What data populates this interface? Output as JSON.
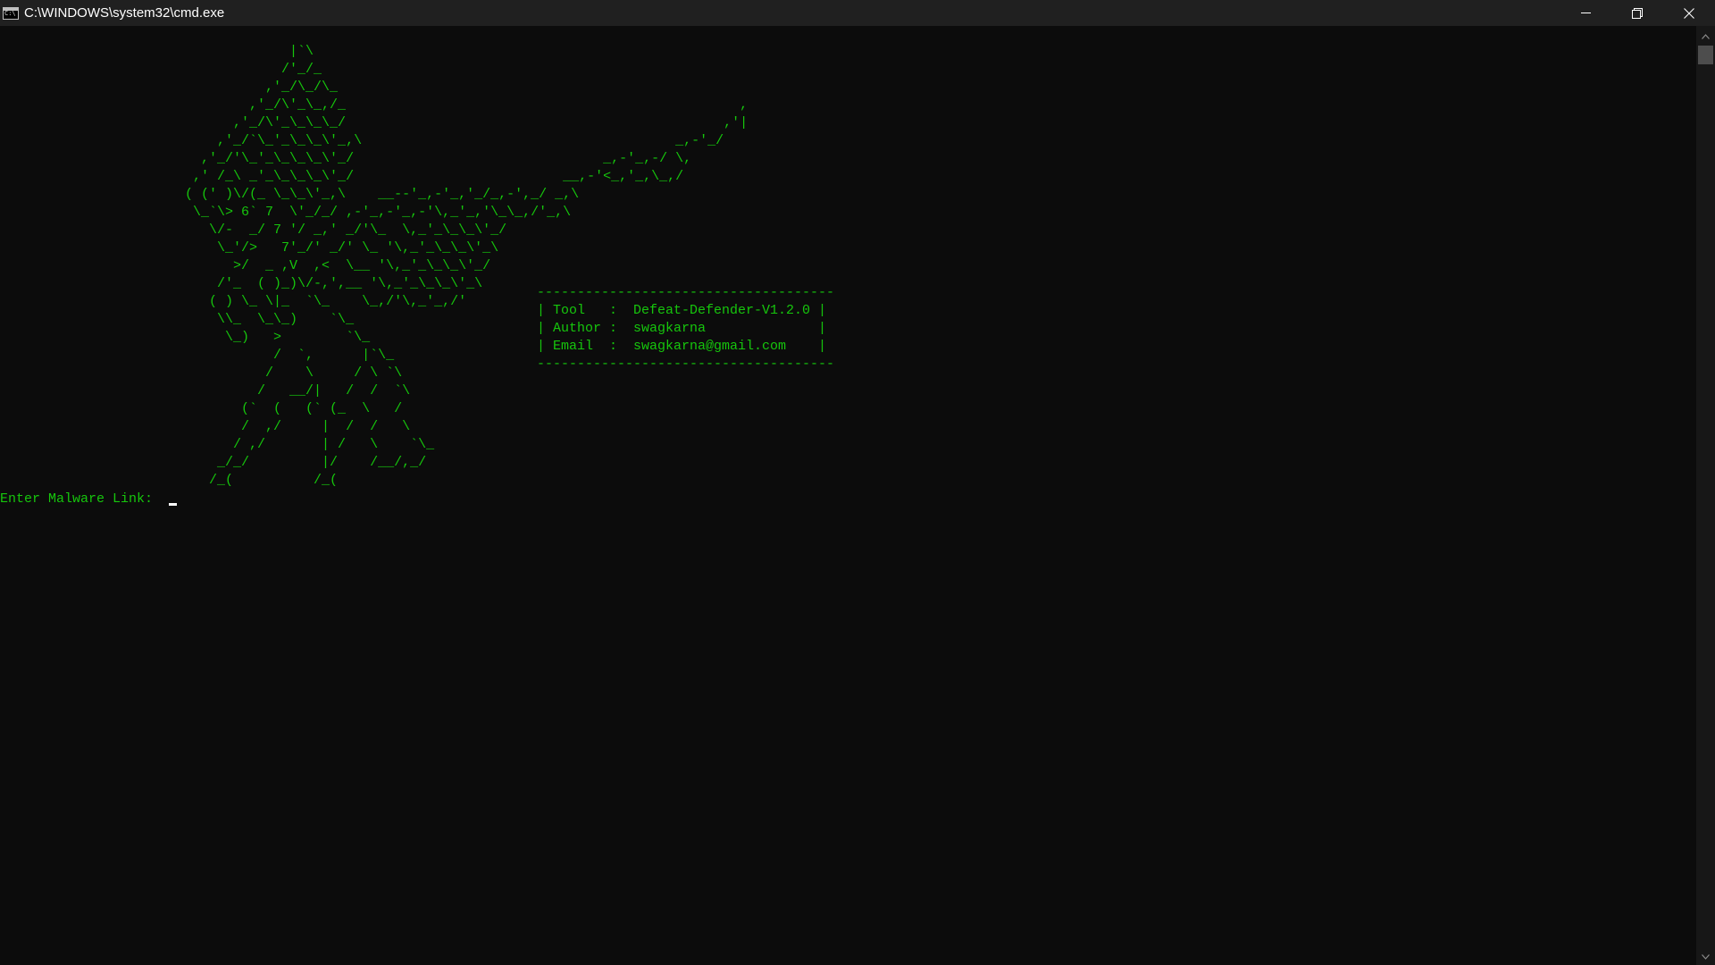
{
  "window": {
    "title": "C:\\WINDOWS\\system32\\cmd.exe",
    "icon": "cmd-console-icon",
    "controls": {
      "minimize_icon": "minimize-icon",
      "restore_icon": "restore-icon",
      "close_icon": "close-icon"
    }
  },
  "console": {
    "foreground_color": "#16c60c",
    "background_color": "#0c0c0c",
    "ascii_art": "                                    |`\\\n                                   /'_/_\n                                 ,'_/\\_/\\_\n                               ,'_/\\'_\\_,/_                                                 ,\n                             ,'_/\\'_\\_\\_\\_/                                               ,'|\n                           ,'_/`\\_'_\\_\\_\\'_,\\                                       _,-'_/\n                         ,'_/'\\_'_\\_\\_\\_\\'_/                               _,-'_,-/ \\,\n                        ,' /_\\ _'_\\_\\_\\_\\'_/                          __,-'<_,'_,\\_,/\n                       ( (' )\\/(_ \\_\\_\\'_,\\    __--'_,-'_,'_/_,-',_/ _,\\\n                        \\_`\\> 6` 7  \\'_/_/ ,-'_,-'_,-'\\,_'_,'\\_\\_,/'_,\\\n                          \\/-  _/ 7 '/ _,' _/'\\_  \\,_'_\\_\\_\\'_/\n                           \\_'/>   7'_/' _/' \\_ '\\,_'_\\_\\_\\'_\\\n                             >/  _ ,V  ,<  \\__ '\\,_'_\\_\\_\\'_/\n                           /'_  ( )_)\\/-,',__ '\\,_'_\\_\\_\\'_\\\n                          ( ) \\_ \\|_  `\\_    \\_,/'\\,_'_,/'\n                           \\\\_  \\_\\_)    `\\_\n                            \\_)   >        `\\_\n                                  /  `,      |`\\_\n                                 /    \\     / \\ `\\\n                                /   __/|   /  /  `\\\n                              (`  (   (` (_  \\   /\n                              /  ,/     |  /  /   \\\n                             / ,/       | /   \\    `\\_\n                           _/_/         |/    /__/,_/\n                          /_(          /_(",
    "info_box": "-------------------------------------\n| Tool   :  Defeat-Defender-V1.2.0 |\n| Author :  swagkarna              |\n| Email  :  swagkarna@gmail.com    |\n-------------------------------------",
    "prompt": {
      "label": "Enter Malware Link: ",
      "value": ""
    }
  },
  "scrollbar": {
    "up_icon": "scroll-up-arrow-icon",
    "down_icon": "scroll-down-arrow-icon"
  }
}
